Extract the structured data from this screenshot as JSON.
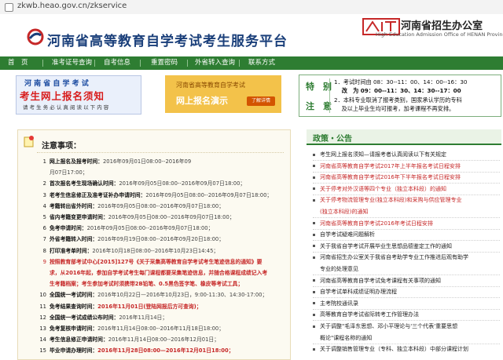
{
  "browser": {
    "url": "zkwb.heao.gov.cn/zkservice"
  },
  "header": {
    "site_title": "河南省高等教育自学考试考生服务平台",
    "office_name": "河南省招生办公室",
    "office_en": "High Education Admission Office of HENAN Province"
  },
  "nav": {
    "items": [
      "首　页",
      "准考证号查询",
      "自考信息",
      "重置密码",
      "外省转入查询",
      "联系方式"
    ]
  },
  "banner_left": {
    "line1": "河 南 省 自 学 考 试",
    "line2": "考生网上报名须知",
    "line3": "请 考 生 务 必 认 真 阅 读 以 下 内 容"
  },
  "banner_mid": {
    "line1": "河南省高等教育自学考试",
    "line2": "网上报名演示",
    "button": "了解详情"
  },
  "special_notice": {
    "label_top": "特　别",
    "label_bottom": "注　意",
    "lines": [
      "1．考试时间由 08：30--11：00、14：00--16：30",
      "　 改　为 09：00--11：30、14：30--17：00",
      "2．本科专业取消了报考类别，国家承认学历的专科",
      "　 及以上毕业生均可报考，加考课程不再安排。"
    ]
  },
  "notes": {
    "title": "注意事项：",
    "items": [
      {
        "n": "1",
        "label": "网上报名及报考时间：",
        "value": "2016年09月01日08:00--2016年09",
        "red": false
      },
      {
        "n": "",
        "label": "",
        "value": "月07日17:00；",
        "red": false
      },
      {
        "n": "2",
        "label": "首次报名考生现场确认时间：",
        "value": "2016年09月05日08:00--2016年09月07日18:00；",
        "red": false
      },
      {
        "n": "3",
        "label": "老考生信息修正及准考证补办申请时间：",
        "value": "2016年09月05日08:00--2016年09月07日18:00；",
        "red": false
      },
      {
        "n": "4",
        "label": "考籍转出省外时间：",
        "value": "2016年09月05日08:00--2016年09月07日18:00；",
        "red": false
      },
      {
        "n": "5",
        "label": "省内考籍变更申请时间：",
        "value": "2016年09月05日08:00--2016年09月07日18:00；",
        "red": false
      },
      {
        "n": "6",
        "label": "免考申请时间：",
        "value": "2016年09月05日08:00--2016年09月07日18:00；",
        "red": false
      },
      {
        "n": "7",
        "label": "外省考籍转入时间：",
        "value": "2016年09月19日08:00--2016年09月20日18:00；",
        "red": false
      },
      {
        "n": "8",
        "label": "打印准考单时间：",
        "value": "2016年10月18日08:00--2016年10月23日14:45；",
        "red": false
      },
      {
        "n": "9",
        "label": "按照教育部考试中心[2015]127号《关于采集高等教育自学考试考生笔迹信息的通知》要",
        "value": "",
        "red": true
      },
      {
        "n": "",
        "label": "求，从2016年起，参加自学考试考生每门课程都要采集笔迹信息，并随合格课程成绩记入考",
        "value": "",
        "red": true
      },
      {
        "n": "",
        "label": "生考籍档案；考生参加考试时须携带2B铅笔、0.5黑色签字笔、橡皮等考试工具；",
        "value": "",
        "red": true
      },
      {
        "n": "10",
        "label": "全国统一考试时间：",
        "value": "2016年10月22日—2016年10月23日，9:00-11:30、14:30-17:00；",
        "red": false
      },
      {
        "n": "11",
        "label": "免考结果查询时间：",
        "value": "2016年11月01日(登陆网报后方可查询)；",
        "red": false,
        "vred": true
      },
      {
        "n": "12",
        "label": "全国统一考试成绩公布时间：",
        "value": "2016年11月14日；",
        "red": false
      },
      {
        "n": "13",
        "label": "免考复核申请时间：",
        "value": "2016年11月14日08:00--2016年11月18日18:00；",
        "red": false
      },
      {
        "n": "14",
        "label": "考生信息修正申请时间：",
        "value": "2016年11月14日08:00--2016年12月01日；",
        "red": false
      },
      {
        "n": "15",
        "label": "毕业申请办理时间：",
        "value": "2016年11月28日08:00—2016年12月01日18:00；",
        "red": false,
        "vred": true
      }
    ]
  },
  "news": {
    "title": "政策・公告",
    "items": [
      {
        "text": "考生网上报名须知—请报考者认真阅读以下有关规定",
        "red": false
      },
      {
        "text": "河南省高等教育自学考试2017年上半年报名考试日程安排",
        "red": true
      },
      {
        "text": "河南省高等教育自学考试2016年下半年报名考试日程安排",
        "red": true
      },
      {
        "text": "关于停考对外汉语等四个专业（独立本科段）的通知",
        "red": true
      },
      {
        "text": "关于停考物流管理专业(独立本科段)和采购与供应管理专业",
        "red": true
      },
      {
        "text": "(独立本科段)的通知",
        "red": true,
        "cont": true
      },
      {
        "text": "河南省高等教育自学考试2016年考试日程安排",
        "red": true
      },
      {
        "text": "自学考试疑难问题解析",
        "red": false
      },
      {
        "text": "关于我省自学考试开展毕业生思想品德鉴定工作的通知",
        "red": false
      },
      {
        "text": "河南省招生办公室关于我省自考助学专业工作推进后观有助学",
        "red": false
      },
      {
        "text": "专业的处理意见",
        "red": false,
        "cont": true
      },
      {
        "text": "河南省高等教育自学考试免考课程有关事项的通知",
        "red": false
      },
      {
        "text": "自学考试单科成绩证明办理流程",
        "red": false
      },
      {
        "text": "主考院校通讯录",
        "red": false
      },
      {
        "text": "高等教育自学考试省际转考工作管理办法",
        "red": false
      },
      {
        "text": "关于调整\"毛泽东思想、邓小平理论与'三个代表'重要思想",
        "red": false
      },
      {
        "text": "概论\"课程名称的通知",
        "red": false,
        "cont": true
      },
      {
        "text": "关于调整销售管理专业（专科、独立本科段）中部分课程计划",
        "red": false
      }
    ]
  }
}
